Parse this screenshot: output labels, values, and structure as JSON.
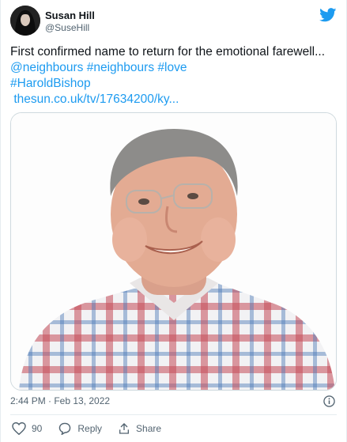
{
  "author": {
    "display_name": "Susan Hill",
    "handle": "@SuseHill"
  },
  "tweet": {
    "text_lead": "First confirmed name to return for the emotional farewell...",
    "hashtags": [
      "@neighbours",
      "#neighbours",
      "#love",
      "#HaroldBishop"
    ],
    "link": "thesun.co.uk/tv/17634200/ky..."
  },
  "timestamp": "2:44 PM · Feb 13, 2022",
  "actions": {
    "likes_count": "90",
    "reply_label": "Reply",
    "share_label": "Share"
  },
  "icons": {
    "brand": "twitter-bird-icon",
    "info": "info-icon",
    "like": "heart-icon",
    "reply": "reply-bubble-icon",
    "share": "share-icon"
  },
  "colors": {
    "accent": "#1d9bf0",
    "text": "#0f1419",
    "muted": "#536471"
  }
}
